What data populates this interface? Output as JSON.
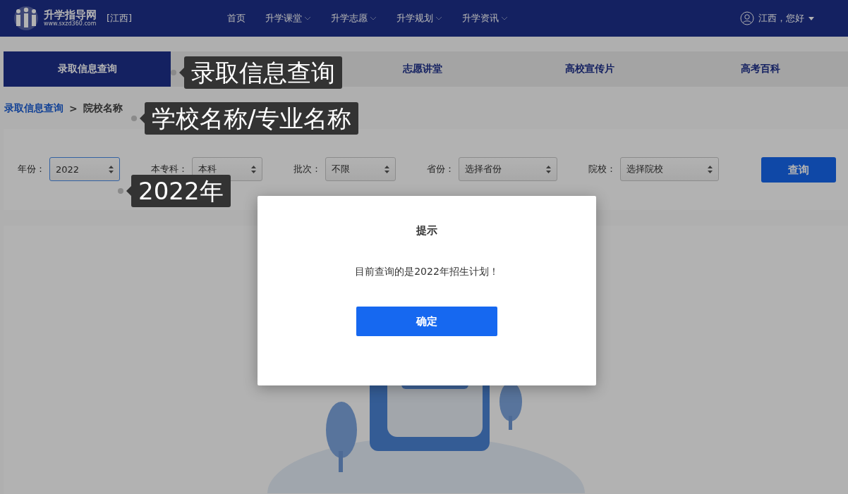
{
  "header": {
    "logo_name": "升学指导网",
    "logo_url": "www.sxzd360.com",
    "region": "[江西]",
    "nav": [
      {
        "label": "首页",
        "dropdown": false
      },
      {
        "label": "升学课堂",
        "dropdown": true
      },
      {
        "label": "升学志愿",
        "dropdown": true
      },
      {
        "label": "升学规划",
        "dropdown": true
      },
      {
        "label": "升学资讯",
        "dropdown": true
      }
    ],
    "user": "江西，您好"
  },
  "tabs": [
    {
      "label": "录取信息查询",
      "selected": true
    },
    {
      "label": "志愿讲堂",
      "selected": false
    },
    {
      "label": "高校宣传片",
      "selected": false
    },
    {
      "label": "高考百科",
      "selected": false
    }
  ],
  "breadcrumb": {
    "items": [
      "录取信息查询",
      "院校名称"
    ],
    "separator": ">"
  },
  "filters": [
    {
      "label": "年份：",
      "value": "2022",
      "focused": true
    },
    {
      "label": "本专科：",
      "value": "本科",
      "focused": false
    },
    {
      "label": "批次：",
      "value": "不限",
      "focused": false
    },
    {
      "label": "省份：",
      "value": "选择省份",
      "focused": false
    },
    {
      "label": "院校：",
      "value": "选择院校",
      "focused": false
    }
  ],
  "search_button": "查询",
  "dialog": {
    "title": "提示",
    "message": "目前查询的是2022年招生计划！",
    "button": "确定"
  },
  "tooltips": [
    {
      "text": "录取信息查询"
    },
    {
      "text": "学校名称/专业名称"
    },
    {
      "text": "2022年"
    }
  ]
}
